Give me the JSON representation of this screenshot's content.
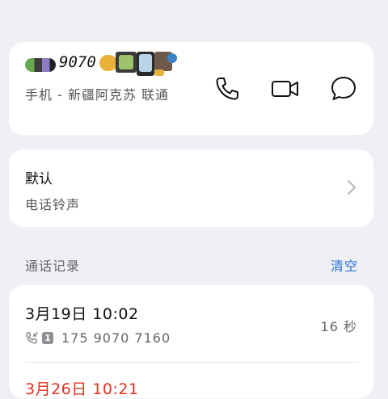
{
  "contact": {
    "name_visible": "9070",
    "subtitle": "手机 - 新疆阿克苏 联通",
    "actions": [
      {
        "name": "call",
        "icon": "phone-icon"
      },
      {
        "name": "video",
        "icon": "video-camera-icon"
      },
      {
        "name": "message",
        "icon": "chat-bubble-icon"
      }
    ]
  },
  "ringtone": {
    "title": "默认",
    "subtitle": "电话铃声",
    "icon": "chevron-right-icon"
  },
  "history": {
    "label": "通话记录",
    "clear_label": "清空",
    "calls": [
      {
        "date": "3月19日 10:02",
        "sim": "1",
        "number": "175 9070 7160",
        "duration": "16 秒",
        "icon": "incoming-call-icon"
      },
      {
        "date": "3月26日 10:21",
        "missed": true
      }
    ]
  },
  "colors": {
    "background": "#eef0f4",
    "card": "#ffffff",
    "accent": "#2a6fd6",
    "missed": "#e0321e"
  }
}
